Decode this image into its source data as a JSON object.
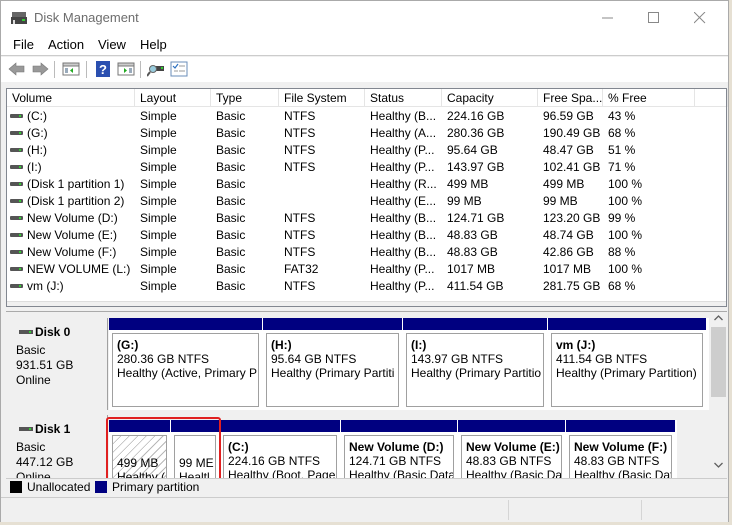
{
  "window": {
    "title": "Disk Management",
    "minimize_label": "Minimize",
    "maximize_label": "Maximize",
    "close_label": "Close"
  },
  "menu": [
    "File",
    "Action",
    "View",
    "Help"
  ],
  "toolbar": {
    "icons": [
      "back-icon",
      "forward-icon",
      "show-hide-console-tree-icon",
      "help-icon",
      "show-hide-action-pane-icon",
      "connect-icon",
      "properties-icon"
    ]
  },
  "volume_list": {
    "columns": [
      "Volume",
      "Layout",
      "Type",
      "File System",
      "Status",
      "Capacity",
      "Free Spa...",
      "% Free"
    ],
    "rows": [
      {
        "volume": "(C:)",
        "layout": "Simple",
        "type": "Basic",
        "fs": "NTFS",
        "status": "Healthy (B...",
        "capacity": "224.16 GB",
        "free": "96.59 GB",
        "pct": "43 %"
      },
      {
        "volume": "(G:)",
        "layout": "Simple",
        "type": "Basic",
        "fs": "NTFS",
        "status": "Healthy (A...",
        "capacity": "280.36 GB",
        "free": "190.49 GB",
        "pct": "68 %"
      },
      {
        "volume": "(H:)",
        "layout": "Simple",
        "type": "Basic",
        "fs": "NTFS",
        "status": "Healthy (P...",
        "capacity": "95.64 GB",
        "free": "48.47 GB",
        "pct": "51 %"
      },
      {
        "volume": "(I:)",
        "layout": "Simple",
        "type": "Basic",
        "fs": "NTFS",
        "status": "Healthy (P...",
        "capacity": "143.97 GB",
        "free": "102.41 GB",
        "pct": "71 %"
      },
      {
        "volume": "(Disk 1 partition 1)",
        "layout": "Simple",
        "type": "Basic",
        "fs": "",
        "status": "Healthy (R...",
        "capacity": "499 MB",
        "free": "499 MB",
        "pct": "100 %"
      },
      {
        "volume": "(Disk 1 partition 2)",
        "layout": "Simple",
        "type": "Basic",
        "fs": "",
        "status": "Healthy (E...",
        "capacity": "99 MB",
        "free": "99 MB",
        "pct": "100 %"
      },
      {
        "volume": "New Volume (D:)",
        "layout": "Simple",
        "type": "Basic",
        "fs": "NTFS",
        "status": "Healthy (B...",
        "capacity": "124.71 GB",
        "free": "123.20 GB",
        "pct": "99 %"
      },
      {
        "volume": "New Volume (E:)",
        "layout": "Simple",
        "type": "Basic",
        "fs": "NTFS",
        "status": "Healthy (B...",
        "capacity": "48.83 GB",
        "free": "48.74 GB",
        "pct": "100 %"
      },
      {
        "volume": "New Volume (F:)",
        "layout": "Simple",
        "type": "Basic",
        "fs": "NTFS",
        "status": "Healthy (B...",
        "capacity": "48.83 GB",
        "free": "42.86 GB",
        "pct": "88 %"
      },
      {
        "volume": "NEW VOLUME (L:)",
        "layout": "Simple",
        "type": "Basic",
        "fs": "FAT32",
        "status": "Healthy (P...",
        "capacity": "1017 MB",
        "free": "1017 MB",
        "pct": "100 %"
      },
      {
        "volume": "vm (J:)",
        "layout": "Simple",
        "type": "Basic",
        "fs": "NTFS",
        "status": "Healthy (P...",
        "capacity": "411.54 GB",
        "free": "281.75 GB",
        "pct": "68 %"
      }
    ]
  },
  "disks": [
    {
      "name": "Disk 0",
      "type": "Basic",
      "size": "931.51 GB",
      "state": "Online",
      "partitions": [
        {
          "title": " (G:)",
          "size": "280.36 GB NTFS",
          "status": "Healthy (Active, Primary P"
        },
        {
          "title": " (H:)",
          "size": "95.64 GB NTFS",
          "status": "Healthy (Primary Partiti"
        },
        {
          "title": " (I:)",
          "size": "143.97 GB NTFS",
          "status": "Healthy (Primary Partitio"
        },
        {
          "title": "vm  (J:)",
          "size": "411.54 GB NTFS",
          "status": "Healthy (Primary Partition)"
        }
      ]
    },
    {
      "name": "Disk 1",
      "type": "Basic",
      "size": "447.12 GB",
      "state": "Online",
      "partitions": [
        {
          "title": "",
          "size": "499 MB",
          "status": "Healthy (",
          "hatched": true
        },
        {
          "title": "",
          "size": "99 ME",
          "status": "Healtl"
        },
        {
          "title": " (C:)",
          "size": "224.16 GB NTFS",
          "status": "Healthy (Boot, Page"
        },
        {
          "title": "New Volume  (D:)",
          "size": "124.71 GB NTFS",
          "status": "Healthy (Basic Data"
        },
        {
          "title": "New Volume  (E:)",
          "size": "48.83 GB NTFS",
          "status": "Healthy (Basic Da"
        },
        {
          "title": "New Volume  (F:)",
          "size": "48.83 GB NTFS",
          "status": "Healthy (Basic Dat"
        }
      ]
    }
  ],
  "legend": [
    {
      "label": "Unallocated",
      "color": "#000000"
    },
    {
      "label": "Primary partition",
      "color": "#000080"
    }
  ],
  "colors": {
    "primary_partition": "#000080",
    "highlight": "#e02020"
  }
}
